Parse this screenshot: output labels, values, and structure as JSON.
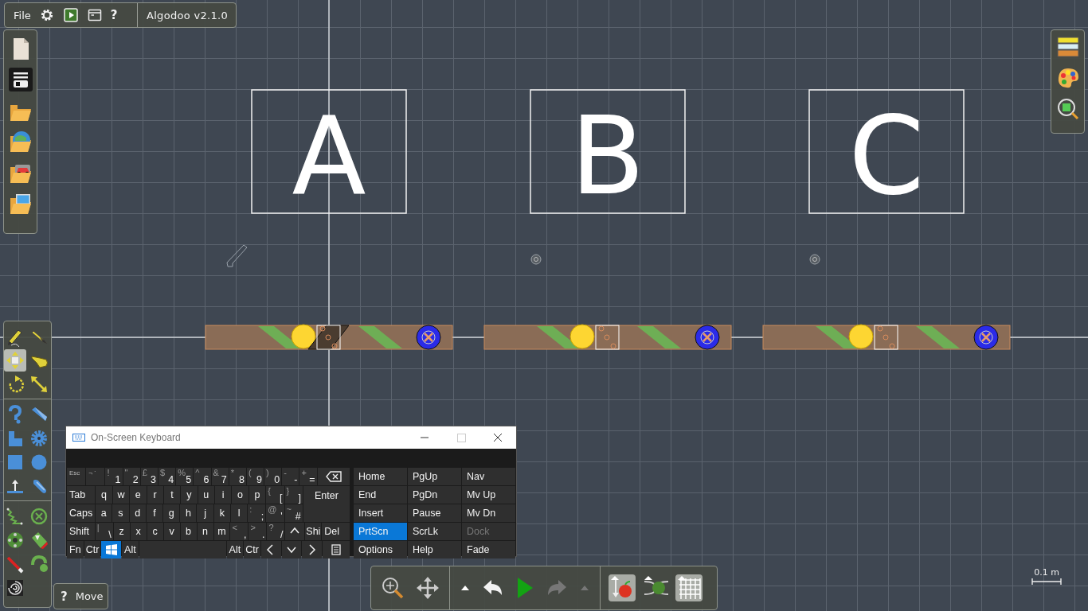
{
  "menu_bar": {
    "file": "File",
    "help": "?",
    "version": "Algodoo v2.1.0"
  },
  "scene": {
    "objects": [
      {
        "label": "A",
        "kind": "sketch"
      },
      {
        "label": "B",
        "kind": "pin"
      },
      {
        "label": "C",
        "kind": "pin"
      }
    ]
  },
  "tool_groups": [
    [
      {
        "selected": false
      },
      {
        "selected": false
      },
      {
        "selected": true
      },
      {
        "selected": false
      },
      {
        "selected": false
      },
      {
        "selected": false
      }
    ],
    [
      {
        "selected": false
      },
      {
        "selected": false
      },
      {
        "selected": false
      },
      {
        "selected": false
      },
      {
        "selected": false
      },
      {
        "selected": false
      },
      {
        "selected": false
      },
      {
        "selected": false
      }
    ],
    [
      {
        "selected": false
      },
      {
        "selected": false
      },
      {
        "selected": false
      },
      {
        "selected": false
      },
      {
        "selected": false
      },
      {
        "selected": false
      },
      {
        "selected": false
      }
    ]
  ],
  "help_chip": {
    "icon": "?",
    "label": "Move"
  },
  "sim_toolbar": {
    "redo_disabled": true,
    "toggles": [
      {
        "on": true
      },
      {
        "on": false
      },
      {
        "on": true
      }
    ]
  },
  "scale_bar": {
    "label": "0.1 m"
  },
  "keyboard": {
    "title": "On-Screen Keyboard",
    "key_lines": [
      [
        {
          "kind": "small",
          "main": "Esc"
        },
        {
          "kind": "small",
          "main": "¬ `"
        },
        {
          "kind": "dual",
          "top": "!",
          "main": "1"
        },
        {
          "kind": "dual",
          "top": "\"",
          "main": "2"
        },
        {
          "kind": "dual",
          "top": "£",
          "main": "3"
        },
        {
          "kind": "dual",
          "top": "$",
          "main": "4"
        },
        {
          "kind": "dual",
          "top": "%",
          "main": "5"
        },
        {
          "kind": "dual",
          "top": "^",
          "main": "6"
        },
        {
          "kind": "dual",
          "top": "&",
          "main": "7"
        },
        {
          "kind": "dual",
          "top": "*",
          "main": "8"
        },
        {
          "kind": "dual",
          "top": "(",
          "main": "9"
        },
        {
          "kind": "dual",
          "top": ")",
          "main": "0"
        },
        {
          "kind": "dual",
          "top": "-",
          "main": "-"
        },
        {
          "kind": "dual",
          "top": "+",
          "main": "="
        },
        {
          "kind": "backspace"
        }
      ],
      [
        {
          "kind": "wide",
          "main": "Tab"
        },
        {
          "kind": "text",
          "main": "q"
        },
        {
          "kind": "text",
          "main": "w"
        },
        {
          "kind": "text",
          "main": "e"
        },
        {
          "kind": "text",
          "main": "r"
        },
        {
          "kind": "text",
          "main": "t"
        },
        {
          "kind": "text",
          "main": "y"
        },
        {
          "kind": "text",
          "main": "u"
        },
        {
          "kind": "text",
          "main": "i"
        },
        {
          "kind": "text",
          "main": "o"
        },
        {
          "kind": "text",
          "main": "p"
        },
        {
          "kind": "dual",
          "top": "{",
          "main": "["
        },
        {
          "kind": "dual",
          "top": "}",
          "main": "]"
        },
        {
          "kind": "enter",
          "main": "Enter"
        }
      ],
      [
        {
          "kind": "wide",
          "main": "Caps"
        },
        {
          "kind": "text",
          "main": "a"
        },
        {
          "kind": "text",
          "main": "s"
        },
        {
          "kind": "text",
          "main": "d"
        },
        {
          "kind": "text",
          "main": "f"
        },
        {
          "kind": "text",
          "main": "g"
        },
        {
          "kind": "text",
          "main": "h"
        },
        {
          "kind": "text",
          "main": "j"
        },
        {
          "kind": "text",
          "main": "k"
        },
        {
          "kind": "text",
          "main": "l"
        },
        {
          "kind": "dual",
          "top": ":",
          "main": ";"
        },
        {
          "kind": "dual",
          "top": "@",
          "main": "'"
        },
        {
          "kind": "dual",
          "top": "~",
          "main": "#"
        }
      ],
      [
        {
          "kind": "wide",
          "main": "Shift"
        },
        {
          "kind": "dual",
          "top": "|",
          "main": "\\"
        },
        {
          "kind": "text",
          "main": "z"
        },
        {
          "kind": "text",
          "main": "x"
        },
        {
          "kind": "text",
          "main": "c"
        },
        {
          "kind": "text",
          "main": "v"
        },
        {
          "kind": "text",
          "main": "b"
        },
        {
          "kind": "text",
          "main": "n"
        },
        {
          "kind": "text",
          "main": "m"
        },
        {
          "kind": "dual",
          "top": "<",
          "main": ","
        },
        {
          "kind": "dual",
          "top": ">",
          "main": "."
        },
        {
          "kind": "dual",
          "top": "?",
          "main": "/"
        },
        {
          "kind": "up"
        },
        {
          "kind": "text",
          "main": "Shi"
        },
        {
          "kind": "wide",
          "main": "Del"
        }
      ],
      [
        {
          "kind": "text",
          "main": "Fn"
        },
        {
          "kind": "text",
          "main": "Ctr"
        },
        {
          "kind": "windows"
        },
        {
          "kind": "text",
          "main": "Alt"
        },
        {
          "kind": "space"
        },
        {
          "kind": "text",
          "main": "Alt"
        },
        {
          "kind": "text",
          "main": "Ctr"
        },
        {
          "kind": "left"
        },
        {
          "kind": "down"
        },
        {
          "kind": "right"
        },
        {
          "kind": "menu"
        }
      ]
    ],
    "nav_keys": [
      {
        "label": "Home",
        "selected": false,
        "disabled": false
      },
      {
        "label": "PgUp",
        "selected": false,
        "disabled": false
      },
      {
        "label": "Nav",
        "selected": false,
        "disabled": false
      },
      {
        "label": "End",
        "selected": false,
        "disabled": false
      },
      {
        "label": "PgDn",
        "selected": false,
        "disabled": false
      },
      {
        "label": "Mv Up",
        "selected": false,
        "disabled": false
      },
      {
        "label": "Insert",
        "selected": false,
        "disabled": false
      },
      {
        "label": "Pause",
        "selected": false,
        "disabled": false
      },
      {
        "label": "Mv Dn",
        "selected": false,
        "disabled": false
      },
      {
        "label": "PrtScn",
        "selected": true,
        "disabled": false
      },
      {
        "label": "ScrLk",
        "selected": false,
        "disabled": false
      },
      {
        "label": "Dock",
        "selected": false,
        "disabled": true
      },
      {
        "label": "Options",
        "selected": false,
        "disabled": false
      },
      {
        "label": "Help",
        "selected": false,
        "disabled": false
      },
      {
        "label": "Fade",
        "selected": false,
        "disabled": false
      }
    ]
  }
}
